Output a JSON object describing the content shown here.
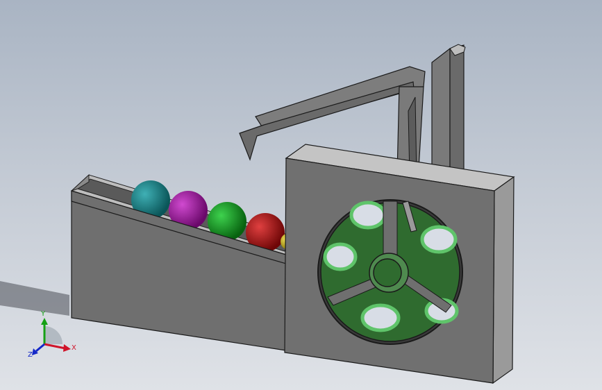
{
  "viewport": {
    "background_top": "#a9b4c3",
    "background_bottom": "#dfe2e7"
  },
  "model": {
    "part_color": "#6f6f6f",
    "part_dark": "#4f4f4f",
    "part_light": "#bdbdbd",
    "wheel_color": "#2f6b2f",
    "wheel_highlight": "#5fc46a",
    "balls": [
      {
        "name": "teal-ball",
        "color": "#127c80"
      },
      {
        "name": "purple-ball",
        "color": "#a515a5"
      },
      {
        "name": "green-ball",
        "color": "#0f9a1f"
      },
      {
        "name": "red-ball",
        "color": "#b30d0d"
      },
      {
        "name": "yellow-ball",
        "color": "#d9c21a"
      }
    ]
  },
  "triad": {
    "x_label": "X",
    "y_label": "Y",
    "z_label": "Z",
    "x_color": "#d0142a",
    "y_color": "#14a014",
    "z_color": "#1428c8"
  }
}
